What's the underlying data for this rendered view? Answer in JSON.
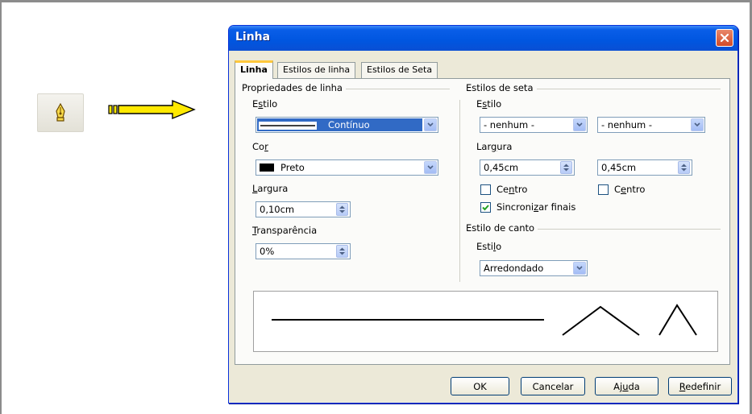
{
  "dialog": {
    "title": "Linha"
  },
  "tabs": [
    {
      "label": "Linha"
    },
    {
      "label": "Estilos de linha"
    },
    {
      "label": "Estilos de Seta"
    }
  ],
  "line_properties": {
    "group_title": "Propriedades de linha",
    "style_label": "Estilo",
    "style_value": "Contínuo",
    "color_label": "Cor",
    "color_value": "Preto",
    "color_swatch": "#000000",
    "width_label": "Largura",
    "width_value": "0,10cm",
    "transparency_label": "Transparência",
    "transparency_value": "0%"
  },
  "arrow_styles": {
    "group_title": "Estilos de seta",
    "style_label": "Estilo",
    "start_style": "- nenhum -",
    "end_style": "- nenhum -",
    "width_label": "Largura",
    "start_width": "0,45cm",
    "end_width": "0,45cm",
    "start_center_label": "Centro",
    "end_center_label": "Centro",
    "sync_label": "Sincronizar finais",
    "sync_checked": true
  },
  "corner_style": {
    "group_title": "Estilo de canto",
    "style_label": "Estilo",
    "style_value": "Arredondado"
  },
  "buttons": {
    "ok": "OK",
    "cancel": "Cancelar",
    "help": "Ajuda",
    "reset": "Redefinir"
  }
}
